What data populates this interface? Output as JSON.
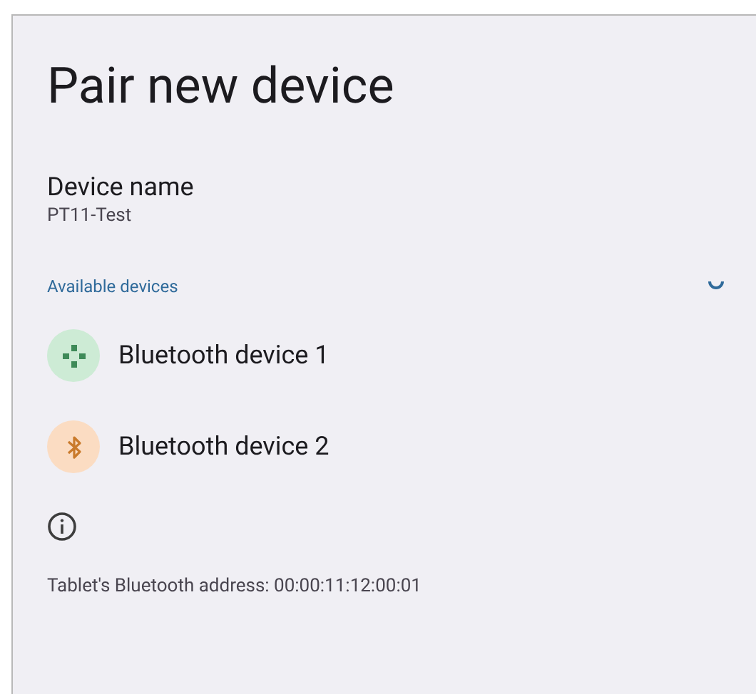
{
  "title": "Pair new device",
  "device_name": {
    "label": "Device name",
    "value": "PT11-Test"
  },
  "available_devices": {
    "heading": "Available devices",
    "scanning": true,
    "items": [
      {
        "kind": "gamepad",
        "name": "Bluetooth device 1"
      },
      {
        "kind": "bluetooth",
        "name": "Bluetooth device 2"
      }
    ]
  },
  "footer": {
    "address": "Tablet's Bluetooth address: 00:00:11:12:00:01"
  }
}
